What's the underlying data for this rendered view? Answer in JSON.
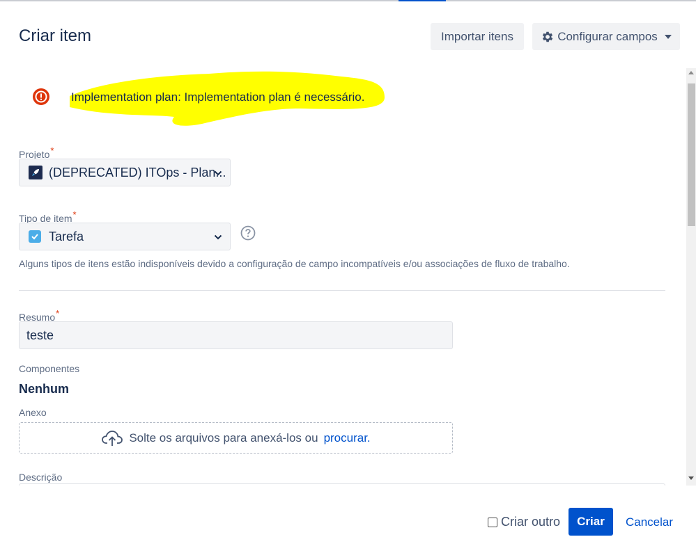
{
  "dialog": {
    "title": "Criar item",
    "import_label": "Importar itens",
    "config_label": "Configurar campos"
  },
  "error": {
    "message": "Implementation plan: Implementation plan é necessário.",
    "highlight_color": "#ffff00"
  },
  "fields": {
    "project": {
      "label": "Projeto",
      "required_mark": "*",
      "value": "(DEPRECATED) ITOps - Plan..."
    },
    "issue_type": {
      "label": "Tipo de item",
      "required_mark": "*",
      "value": "Tarefa",
      "hint": "Alguns tipos de itens estão indisponíveis devido a configuração de campo incompatíveis e/ou associações de fluxo de trabalho."
    },
    "summary": {
      "label": "Resumo",
      "required_mark": "*",
      "value": "teste"
    },
    "components": {
      "label": "Componentes",
      "value": "Nenhum"
    },
    "attachment": {
      "label": "Anexo",
      "drop_text": "Solte os arquivos para anexá-los ou",
      "browse_link": "procurar."
    },
    "description": {
      "label": "Descrição"
    }
  },
  "footer": {
    "create_another_label": "Criar outro",
    "create_label": "Criar",
    "cancel_label": "Cancelar"
  },
  "colors": {
    "primary": "#0052cc",
    "error": "#de350b",
    "text": "#172b4d"
  }
}
